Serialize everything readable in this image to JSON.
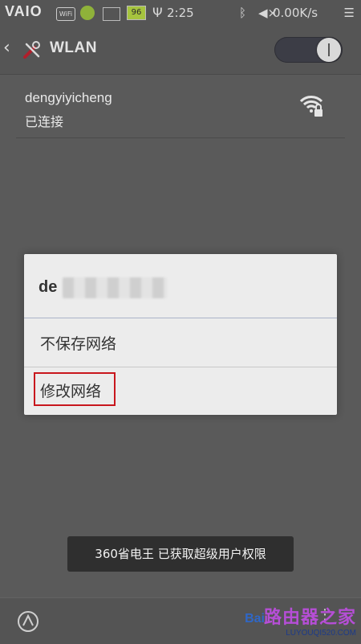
{
  "statusbar": {
    "brand": "VAIO",
    "wifi_chip": "WiFi",
    "battery": "96",
    "usb_icon": "usb-icon",
    "time": "2:25",
    "bluetooth_icon": "bluetooth-icon",
    "mute_icon": "mute-icon",
    "speed": "0.00K/s",
    "menu_icon": "menu-icon"
  },
  "header": {
    "back_icon": "chevron-left-icon",
    "title": "WLAN",
    "toggle_state": "on"
  },
  "network": {
    "name": "dengyiyicheng",
    "status": "已连接",
    "signal_icon": "wifi-locked-icon"
  },
  "dialog": {
    "title_prefix": "de",
    "items": [
      {
        "label": "不保存网络"
      },
      {
        "label": "修改网络"
      }
    ],
    "highlight_color": "#c8171d"
  },
  "toast": {
    "text": "360省电王 已获取超级用户权限"
  },
  "bottom": {
    "left_icon": "rotate-icon",
    "watermark_main": "路由器之家",
    "watermark_sub": "LUYOUQI520.COM",
    "watermark_bai": "Bai"
  },
  "colors": {
    "background": "#5a5a5a",
    "dialog": "#ececec",
    "toast": "#2f2f2f"
  }
}
